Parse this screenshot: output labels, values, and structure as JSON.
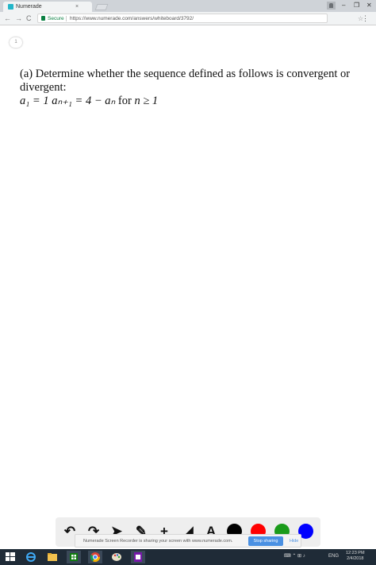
{
  "browser": {
    "tab_title": "Numerade",
    "tab_close": "×",
    "secure_label": "Secure",
    "url": "https://www.numerade.com/answers/whiteboard/3792/",
    "star": "☆",
    "menu": "⋮",
    "back": "←",
    "forward": "→",
    "reload": "C",
    "minimize": "–",
    "restore": "❐",
    "close": "✕"
  },
  "page": {
    "page_number": "1",
    "question_line1": "(a) Determine whether the sequence defined as follows is convergent or divergent:",
    "question_math": "a₁ = 1  aₙ₊₁ = 4 − aₙ",
    "question_for": "for",
    "question_condition": "n ≥ 1"
  },
  "whiteboard_tools": {
    "undo": "↶",
    "redo": "↷",
    "pointer": "➤",
    "pen": "✎",
    "add": "+",
    "eraser": "◢",
    "text": "A",
    "colors": [
      "#000000",
      "#ff0000",
      "#1a9b1a",
      "#0000ff"
    ]
  },
  "screen_share": {
    "message": "Numerade Screen Recorder is sharing your screen with www.numerade.com.",
    "stop_label": "Stop sharing",
    "hide_label": "Hide"
  },
  "taskbar": {
    "language": "ENG",
    "time": "12:23 PM",
    "date": "2/4/2018"
  }
}
